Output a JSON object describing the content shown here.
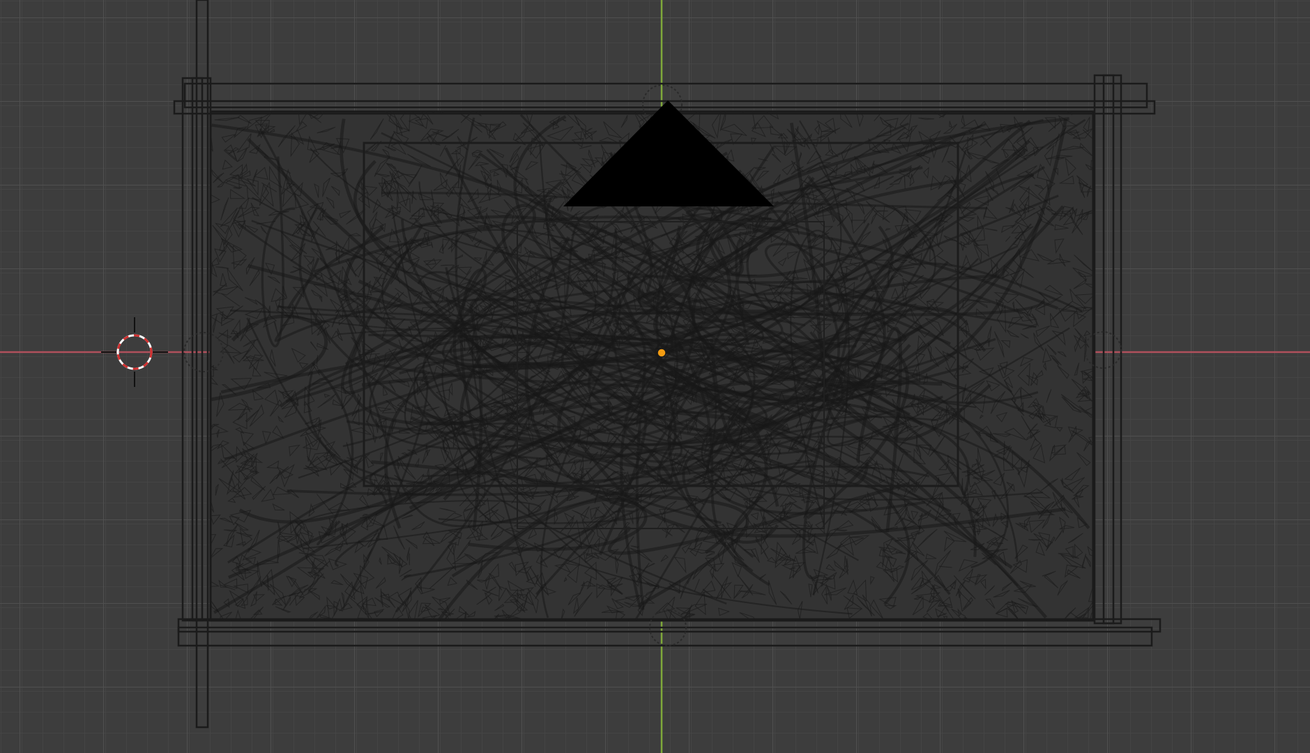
{
  "viewport": {
    "view_mode": "wireframe",
    "background_color": "#3d3d3d",
    "grid": true,
    "grid_minor_color": "#474747",
    "grid_major_color": "#525252",
    "x_axis_color": "#b0505c",
    "y_axis_color": "#7fa83a",
    "origin_color": "#f39c12",
    "wire_color": "#1a1a1a",
    "mesh_fill_color": "#333333",
    "icons": {
      "cursor": "3d-cursor-icon",
      "origin": "object-origin-icon"
    }
  }
}
